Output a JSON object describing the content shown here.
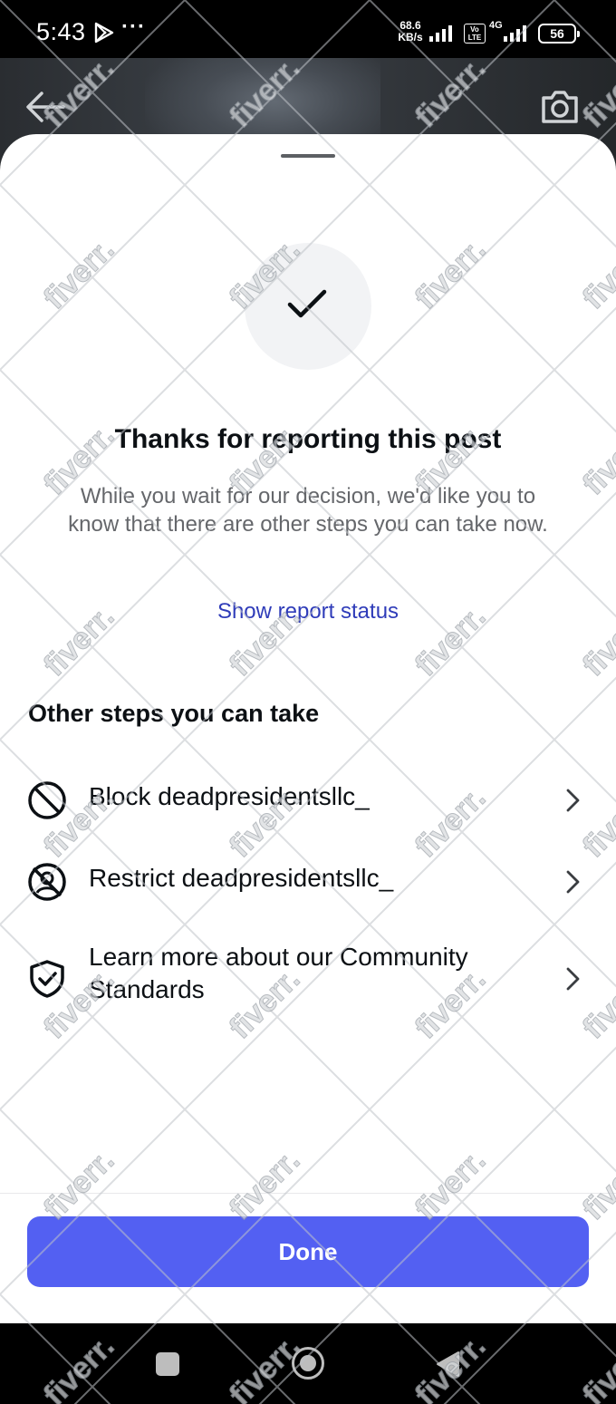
{
  "status_bar": {
    "time": "5:43",
    "dots": "···",
    "speed_value": "68.6",
    "speed_unit": "KB/s",
    "volte": "Vo LTE",
    "network": "4G",
    "battery": "56"
  },
  "sheet": {
    "title": "Thanks for reporting this post",
    "subtitle": "While you wait for our decision, we'd like you to know that there are other steps you can take now.",
    "status_link": "Show report status",
    "section_heading": "Other steps you can take",
    "options": [
      {
        "label": "Block deadpresidentsllc_",
        "icon": "block-icon"
      },
      {
        "label": "Restrict deadpresidentsllc_",
        "icon": "restrict-icon"
      },
      {
        "label": "Learn more about our Community Standards",
        "icon": "shield-check-icon"
      }
    ],
    "done_label": "Done"
  },
  "watermark_text": "fiverr.",
  "colors": {
    "primary_button": "#5360f2",
    "link": "#2f3cb9",
    "text_primary": "#0c1014",
    "text_secondary": "#65676b"
  }
}
